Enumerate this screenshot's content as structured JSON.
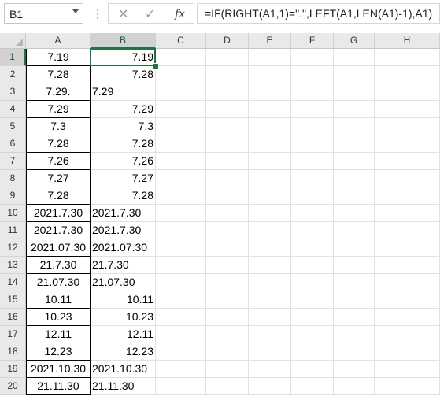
{
  "formula_bar": {
    "name_box": "B1",
    "cancel_icon": "✕",
    "enter_icon": "✓",
    "fx_label": "fx",
    "formula": "=IF(RIGHT(A1,1)=\".\",LEFT(A1,LEN(A1)-1),A1)"
  },
  "columns": [
    "A",
    "B",
    "C",
    "D",
    "E",
    "F",
    "G",
    "H"
  ],
  "rows": [
    {
      "num": "1",
      "a": "7.19",
      "b": "7.19",
      "b_align": "right"
    },
    {
      "num": "2",
      "a": "7.28",
      "b": "7.28",
      "b_align": "right"
    },
    {
      "num": "3",
      "a": "7.29.",
      "b": "7.29",
      "b_align": "left"
    },
    {
      "num": "4",
      "a": "7.29",
      "b": "7.29",
      "b_align": "right"
    },
    {
      "num": "5",
      "a": "7.3",
      "b": "7.3",
      "b_align": "right"
    },
    {
      "num": "6",
      "a": "7.28",
      "b": "7.28",
      "b_align": "right"
    },
    {
      "num": "7",
      "a": "7.26",
      "b": "7.26",
      "b_align": "right"
    },
    {
      "num": "8",
      "a": "7.27",
      "b": "7.27",
      "b_align": "right"
    },
    {
      "num": "9",
      "a": "7.28",
      "b": "7.28",
      "b_align": "right"
    },
    {
      "num": "10",
      "a": "2021.7.30",
      "b": "2021.7.30",
      "b_align": "left"
    },
    {
      "num": "11",
      "a": "2021.7.30",
      "b": "2021.7.30",
      "b_align": "left"
    },
    {
      "num": "12",
      "a": "2021.07.30",
      "b": "2021.07.30",
      "b_align": "left"
    },
    {
      "num": "13",
      "a": "21.7.30",
      "b": "21.7.30",
      "b_align": "left"
    },
    {
      "num": "14",
      "a": "21.07.30",
      "b": "21.07.30",
      "b_align": "left"
    },
    {
      "num": "15",
      "a": "10.11",
      "b": "10.11",
      "b_align": "right"
    },
    {
      "num": "16",
      "a": "10.23",
      "b": "10.23",
      "b_align": "right"
    },
    {
      "num": "17",
      "a": "12.11",
      "b": "12.11",
      "b_align": "right"
    },
    {
      "num": "18",
      "a": "12.23",
      "b": "12.23",
      "b_align": "right"
    },
    {
      "num": "19",
      "a": "2021.10.30",
      "b": "2021.10.30",
      "b_align": "left"
    },
    {
      "num": "20",
      "a": "21.11.30",
      "b": "21.11.30",
      "b_align": "left"
    }
  ],
  "selected_cell": "B1",
  "colors": {
    "selection": "#217346",
    "header_bg": "#e9e9e9",
    "selected_header_bg": "#d2d2d2"
  }
}
